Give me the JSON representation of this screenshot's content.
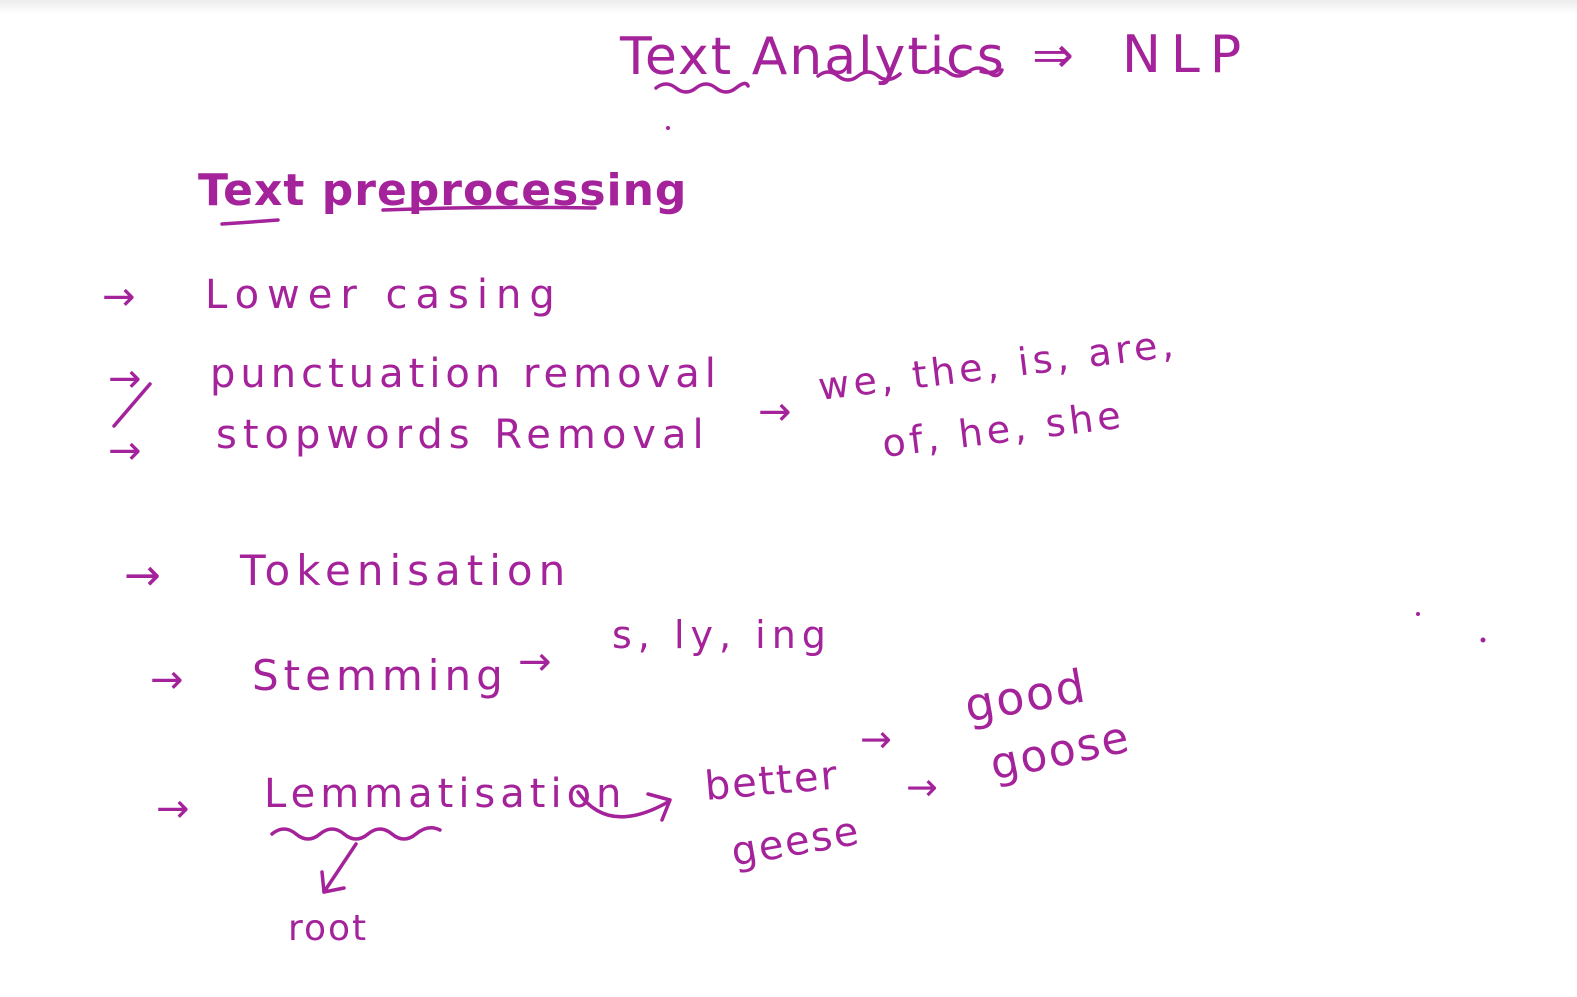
{
  "title": {
    "left": "Text Analytics",
    "arrow": "⇒",
    "right": "NLP"
  },
  "heading": "Text preprocessing",
  "steps": [
    {
      "text": "Lower casing"
    },
    {
      "text": "punctuation removal"
    },
    {
      "text": "stopwords Removal",
      "arrow_to": "we, the, is, are,",
      "continued": "of, he, she"
    },
    {
      "text": "Tokenisation"
    },
    {
      "text": "Stemming",
      "arrow_to": "s, ly, ing"
    },
    {
      "text": "Lemmatisation",
      "below": "root"
    }
  ],
  "lemma_examples": [
    {
      "from": "better",
      "to": "good"
    },
    {
      "from": "geese",
      "to": "goose"
    }
  ],
  "colors": {
    "ink": "#a4229a",
    "background": "#ffffff"
  }
}
